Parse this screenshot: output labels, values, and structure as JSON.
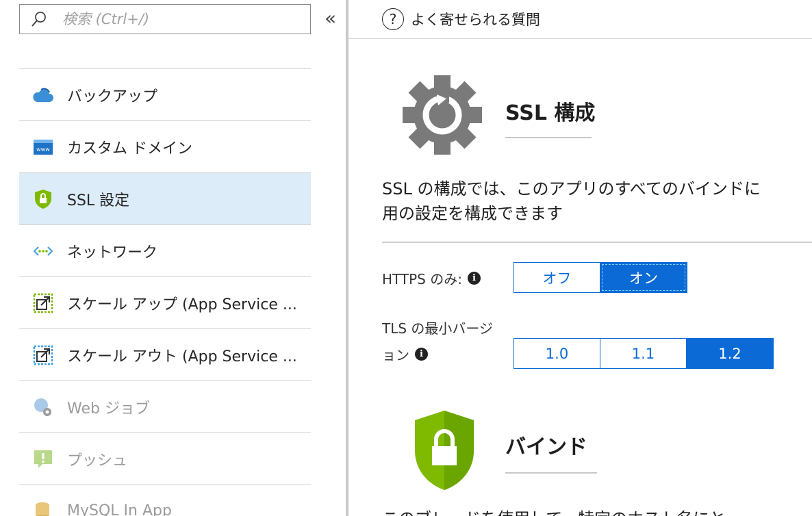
{
  "search": {
    "placeholder": "検索 (Ctrl+/)"
  },
  "sidebar": {
    "collapse_glyph": "«",
    "items": [
      {
        "label": "バックアップ",
        "icon": "cloud-backup-icon"
      },
      {
        "label": "カスタム ドメイン",
        "icon": "www-icon"
      },
      {
        "label": "SSL 設定",
        "icon": "ssl-shield-icon",
        "selected": true
      },
      {
        "label": "ネットワーク",
        "icon": "network-icon"
      },
      {
        "label": "スケール アップ (App Service ...",
        "icon": "scale-up-icon"
      },
      {
        "label": "スケール アウト (App Service ...",
        "icon": "scale-out-icon"
      },
      {
        "label": "Web ジョブ",
        "icon": "webjobs-icon",
        "disabled": true
      },
      {
        "label": "プッシュ",
        "icon": "push-icon",
        "disabled": true
      },
      {
        "label": "MySQL In App",
        "icon": "mysql-icon",
        "disabled": true
      }
    ]
  },
  "topbar": {
    "faq_label": "よく寄せられる質問",
    "faq_glyph": "?"
  },
  "ssl_section": {
    "title": "SSL 構成",
    "description_line1": "SSL の構成では、このアプリのすべてのバインドに",
    "description_line2": "用の設定を構成できます"
  },
  "https_only": {
    "label": "HTTPS のみ:",
    "options": [
      "オフ",
      "オン"
    ],
    "selected": "オン"
  },
  "tls": {
    "label_line1": "TLS の最小バージ",
    "label_line2": "ョン",
    "options": [
      "1.0",
      "1.1",
      "1.2"
    ],
    "selected": "1.2"
  },
  "bindings_section": {
    "title": "バインド",
    "partial_text": "このブレードを使用して、特定のホスト名にと"
  },
  "colors": {
    "accent": "#0b6ad6",
    "selected_bg": "#dcecf9",
    "shield_green": "#7fba00",
    "gear_gray": "#7a7a7a"
  }
}
